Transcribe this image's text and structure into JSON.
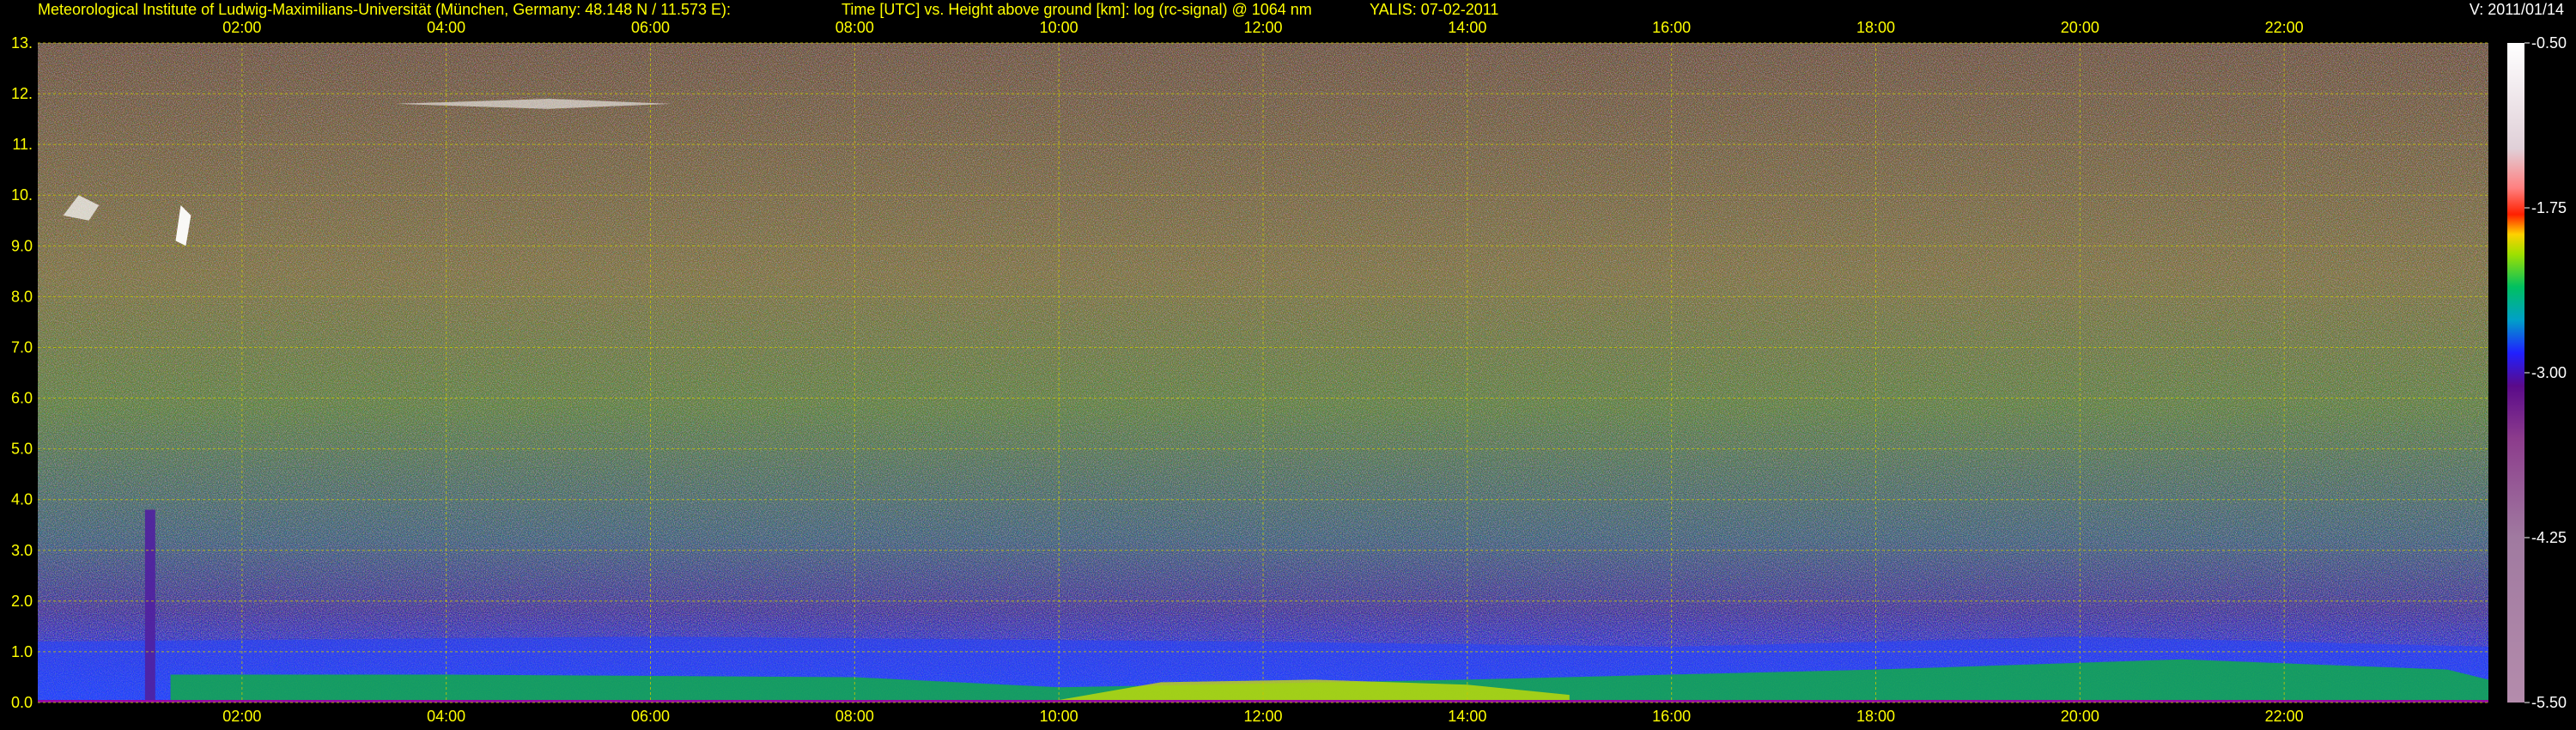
{
  "header": {
    "institute": "Meteorological Institute of Ludwig-Maximilians-Universität (München, Germany: 48.148 N / 11.573 E):",
    "title": "Time [UTC] vs. Height above ground [km]: log (rc-signal) @ 1064 nm",
    "instrument": "YALIS: 07-02-2011",
    "version": "V: 2011/01/14"
  },
  "colors": {
    "axis_text": "#ffff00",
    "grid": "#c8c800",
    "background": "#000000"
  },
  "chart_data": {
    "type": "heatmap",
    "title": "Time [UTC] vs. Height above ground [km]: log (rc-signal) @ 1064 nm",
    "xlabel": "Time [UTC]",
    "ylabel": "Height above ground [km]",
    "x_unit": "hours UTC",
    "xlim": [
      0.0,
      24.0
    ],
    "ylim": [
      0.0,
      13.0
    ],
    "x_ticks": [
      {
        "value": 2,
        "label": "02:00"
      },
      {
        "value": 4,
        "label": "04:00"
      },
      {
        "value": 6,
        "label": "06:00"
      },
      {
        "value": 8,
        "label": "08:00"
      },
      {
        "value": 10,
        "label": "10:00"
      },
      {
        "value": 12,
        "label": "12:00"
      },
      {
        "value": 14,
        "label": "14:00"
      },
      {
        "value": 16,
        "label": "16:00"
      },
      {
        "value": 18,
        "label": "18:00"
      },
      {
        "value": 20,
        "label": "20:00"
      },
      {
        "value": 22,
        "label": "22:00"
      }
    ],
    "y_ticks": [
      {
        "value": 0,
        "label": "0.0"
      },
      {
        "value": 1,
        "label": "1.0"
      },
      {
        "value": 2,
        "label": "2.0"
      },
      {
        "value": 3,
        "label": "3.0"
      },
      {
        "value": 4,
        "label": "4.0"
      },
      {
        "value": 5,
        "label": "5.0"
      },
      {
        "value": 6,
        "label": "6.0"
      },
      {
        "value": 7,
        "label": "7.0"
      },
      {
        "value": 8,
        "label": "8.0"
      },
      {
        "value": 9,
        "label": "9.0"
      },
      {
        "value": 10,
        "label": "10."
      },
      {
        "value": 11,
        "label": "11."
      },
      {
        "value": 12,
        "label": "12."
      },
      {
        "value": 13,
        "label": "13."
      }
    ],
    "grid": true,
    "colorbar": {
      "range": [
        -5.5,
        -0.5
      ],
      "ticks": [
        {
          "value": -0.5,
          "label": "-0.50"
        },
        {
          "value": -1.75,
          "label": "-1.75"
        },
        {
          "value": -3.0,
          "label": "-3.00"
        },
        {
          "value": -4.25,
          "label": "-4.25"
        },
        {
          "value": -5.5,
          "label": "-5.50"
        }
      ],
      "stops": [
        {
          "value": -5.5,
          "color": "#b48cac"
        },
        {
          "value": -4.25,
          "color": "#a07aa0"
        },
        {
          "value": -3.5,
          "color": "#8c3c8c"
        },
        {
          "value": -3.1,
          "color": "#5a0a8a"
        },
        {
          "value": -2.85,
          "color": "#2020ff"
        },
        {
          "value": -2.6,
          "color": "#00a0c8"
        },
        {
          "value": -2.35,
          "color": "#00c060"
        },
        {
          "value": -2.1,
          "color": "#a0e000"
        },
        {
          "value": -1.95,
          "color": "#ffd000"
        },
        {
          "value": -1.8,
          "color": "#ff2000"
        },
        {
          "value": -1.6,
          "color": "#ff8080"
        },
        {
          "value": -1.3,
          "color": "#e0d0d8"
        },
        {
          "value": -0.5,
          "color": "#ffffff"
        }
      ]
    }
  }
}
